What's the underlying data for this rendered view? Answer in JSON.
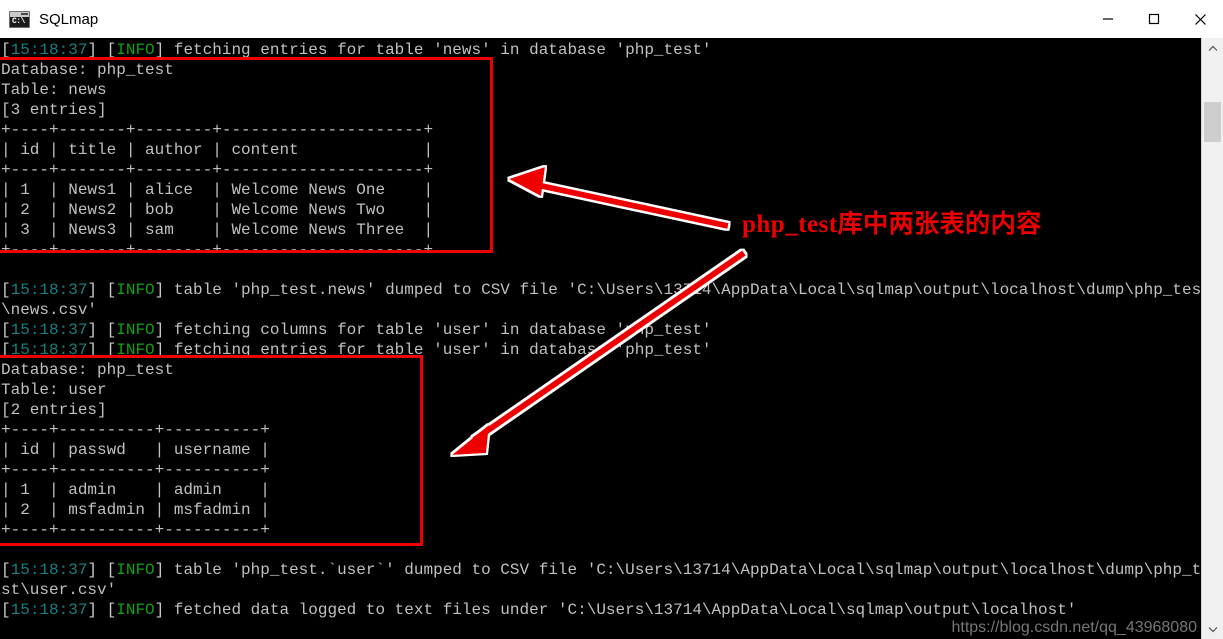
{
  "window": {
    "title": "SQLmap",
    "icon": "cmd-console-icon",
    "prompt_glyph": "C:\\",
    "controls": [
      {
        "name": "minimize",
        "glyph": "minimize-icon"
      },
      {
        "name": "maximize",
        "glyph": "maximize-icon"
      },
      {
        "name": "close",
        "glyph": "close-icon"
      }
    ]
  },
  "console": {
    "background": "#000000",
    "text_color": "#c0c0c0",
    "timestamp_color": "#15807f",
    "info_color": "#11a011",
    "lines": [
      {
        "type": "log",
        "timestamp": "15:18:37",
        "level": "INFO",
        "message": "fetching entries for table 'news' in database 'php_test'"
      },
      {
        "type": "plain",
        "text": "Database: php_test"
      },
      {
        "type": "plain",
        "text": "Table: news"
      },
      {
        "type": "plain",
        "text": "[3 entries]"
      },
      {
        "type": "plain",
        "text": "+----+-------+--------+---------------------+"
      },
      {
        "type": "plain",
        "text": "| id | title | author | content             |"
      },
      {
        "type": "plain",
        "text": "+----+-------+--------+---------------------+"
      },
      {
        "type": "plain",
        "text": "| 1  | News1 | alice  | Welcome News One    |"
      },
      {
        "type": "plain",
        "text": "| 2  | News2 | bob    | Welcome News Two    |"
      },
      {
        "type": "plain",
        "text": "| 3  | News3 | sam    | Welcome News Three  |"
      },
      {
        "type": "plain",
        "text": "+----+-------+--------+---------------------+"
      },
      {
        "type": "blank",
        "text": ""
      },
      {
        "type": "log",
        "timestamp": "15:18:37",
        "level": "INFO",
        "message": "table 'php_test.news' dumped to CSV file 'C:\\Users\\13714\\AppData\\Local\\sqlmap\\output\\localhost\\dump\\php_test\\news.csv'"
      },
      {
        "type": "log",
        "timestamp": "15:18:37",
        "level": "INFO",
        "message": "fetching columns for table 'user' in database 'php_test'"
      },
      {
        "type": "log",
        "timestamp": "15:18:37",
        "level": "INFO",
        "message": "fetching entries for table 'user' in database 'php_test'"
      },
      {
        "type": "plain",
        "text": "Database: php_test"
      },
      {
        "type": "plain",
        "text": "Table: user"
      },
      {
        "type": "plain",
        "text": "[2 entries]"
      },
      {
        "type": "plain",
        "text": "+----+----------+----------+"
      },
      {
        "type": "plain",
        "text": "| id | passwd   | username |"
      },
      {
        "type": "plain",
        "text": "+----+----------+----------+"
      },
      {
        "type": "plain",
        "text": "| 1  | admin    | admin    |"
      },
      {
        "type": "plain",
        "text": "| 2  | msfadmin | msfadmin |"
      },
      {
        "type": "plain",
        "text": "+----+----------+----------+"
      },
      {
        "type": "blank",
        "text": ""
      },
      {
        "type": "log",
        "timestamp": "15:18:37",
        "level": "INFO",
        "message": "table 'php_test.`user`' dumped to CSV file 'C:\\Users\\13714\\AppData\\Local\\sqlmap\\output\\localhost\\dump\\php_test\\user.csv'"
      },
      {
        "type": "log",
        "timestamp": "15:18:37",
        "level": "INFO",
        "message": "fetched data logged to text files under 'C:\\Users\\13714\\AppData\\Local\\sqlmap\\output\\localhost'"
      }
    ],
    "dumped_tables": [
      {
        "database": "php_test",
        "table": "news",
        "entries": 3,
        "columns": [
          "id",
          "title",
          "author",
          "content"
        ],
        "rows": [
          [
            "1",
            "News1",
            "alice",
            "Welcome News One"
          ],
          [
            "2",
            "News2",
            "bob",
            "Welcome News Two"
          ],
          [
            "3",
            "News3",
            "sam",
            "Welcome News Three"
          ]
        ]
      },
      {
        "database": "php_test",
        "table": "user",
        "entries": 2,
        "columns": [
          "id",
          "passwd",
          "username"
        ],
        "rows": [
          [
            "1",
            "admin",
            "admin"
          ],
          [
            "2",
            "msfadmin",
            "msfadmin"
          ]
        ]
      }
    ]
  },
  "annotations": {
    "label": "php_test库中两张表的内容",
    "color": "#ee0000",
    "boxes": [
      {
        "name": "news-table-highlight",
        "target": "news"
      },
      {
        "name": "user-table-highlight",
        "target": "user"
      }
    ],
    "arrows": [
      {
        "name": "arrow-to-news-table",
        "from": "label",
        "to": "news-table-highlight"
      },
      {
        "name": "arrow-to-user-table",
        "from": "label",
        "to": "user-table-highlight"
      }
    ]
  },
  "watermark": {
    "text": "https://blog.csdn.net/qq_43968080"
  },
  "scrollbar": {
    "up_glyph": "chevron-up-icon",
    "down_glyph": "chevron-down-icon",
    "thumb_position": "near-top"
  }
}
